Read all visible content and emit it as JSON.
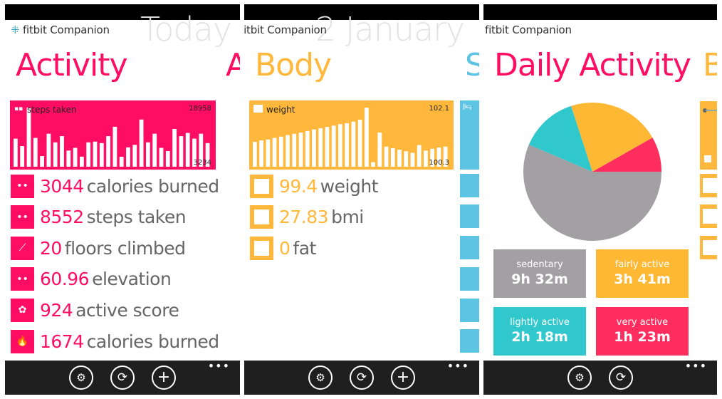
{
  "app_name": "fitbit Companion",
  "colors": {
    "activity": "#ff0d63",
    "body": "#ffb83b",
    "sleep": "#5ec4e4",
    "sedentary": "#a3a0a3",
    "fairly_active": "#ffb833",
    "lightly_active": "#30c8cd",
    "very_active": "#ff2e5f",
    "appbar": "#1f1f1f"
  },
  "screens": [
    {
      "bg_title": "Today",
      "title": "Activity",
      "next_title_peek": "A",
      "chart": {
        "label": "steps taken",
        "icon": "steps-icon",
        "max_label": "18958",
        "min_label": "3234"
      },
      "rows": [
        {
          "icon": "steps-icon",
          "value": "3044",
          "label": "calories burned"
        },
        {
          "icon": "steps-icon",
          "value": "8552",
          "label": "steps taken"
        },
        {
          "icon": "stairs-icon",
          "value": "20",
          "label": "floors climbed"
        },
        {
          "icon": "steps-icon",
          "value": "60.96",
          "label": "elevation"
        },
        {
          "icon": "flower-icon",
          "value": "924",
          "label": "active score"
        },
        {
          "icon": "flame-icon",
          "value": "1674",
          "label": "calories burned"
        }
      ],
      "appbar": [
        "settings",
        "sync",
        "add"
      ],
      "more": "•••"
    },
    {
      "bg_title": "2 January",
      "title": "Body",
      "next_title_peek": "S",
      "chart": {
        "label": "weight",
        "icon": "scale-icon",
        "max_label": "102.1",
        "min_label": "100.3"
      },
      "rows": [
        {
          "icon": "scale-icon",
          "value": "99.4",
          "label": "weight"
        },
        {
          "icon": "scale-icon",
          "value": "27.83",
          "label": "bmi"
        },
        {
          "icon": "scale-icon",
          "value": "0",
          "label": "fat"
        }
      ],
      "appbar": [
        "settings",
        "sync",
        "add"
      ],
      "more": "•••"
    },
    {
      "bg_title": "",
      "title": "Daily Activity",
      "next_title_peek": "B",
      "stats": [
        {
          "label": "sedentary",
          "value": "9h 32m",
          "color_key": "sedentary"
        },
        {
          "label": "fairly active",
          "value": "3h 41m",
          "color_key": "fairly_active"
        },
        {
          "label": "lightly active",
          "value": "2h 18m",
          "color_key": "lightly_active"
        },
        {
          "label": "very active",
          "value": "1h 23m",
          "color_key": "very_active"
        }
      ],
      "appbar": [
        "settings",
        "sync"
      ],
      "more": "•••"
    }
  ],
  "chart_data": [
    {
      "type": "bar",
      "title": "steps taken",
      "ylim": [
        0,
        18958
      ],
      "max_label": 18958,
      "min_label": 3234,
      "values": [
        9000,
        6610,
        18958,
        9240,
        3420,
        10590,
        7810,
        9800,
        5180,
        6050,
        3234,
        7810,
        8050,
        7570,
        9800,
        12820,
        3190,
        6210,
        7010,
        15130,
        7810,
        10590,
        6050,
        5020,
        12100,
        9800,
        10830,
        9000,
        10590,
        7570
      ]
    },
    {
      "type": "bar",
      "title": "weight",
      "ylim": [
        100.3,
        102.1
      ],
      "max_label": 102.1,
      "min_label": 100.3,
      "values": [
        101.0,
        101.05,
        101.08,
        101.13,
        101.17,
        101.22,
        101.26,
        101.3,
        101.35,
        101.4,
        101.44,
        101.48,
        101.52,
        101.57,
        101.6,
        101.65,
        101.71,
        102.1,
        100.35,
        101.3,
        100.85,
        100.8,
        100.75,
        100.7,
        100.65,
        100.9,
        100.72,
        100.78,
        100.82,
        100.85
      ]
    },
    {
      "type": "pie",
      "title": "Daily Activity",
      "labels": [
        "sedentary",
        "fairly active",
        "lightly active",
        "very active"
      ],
      "values_minutes": [
        572,
        221,
        138,
        83
      ]
    }
  ]
}
